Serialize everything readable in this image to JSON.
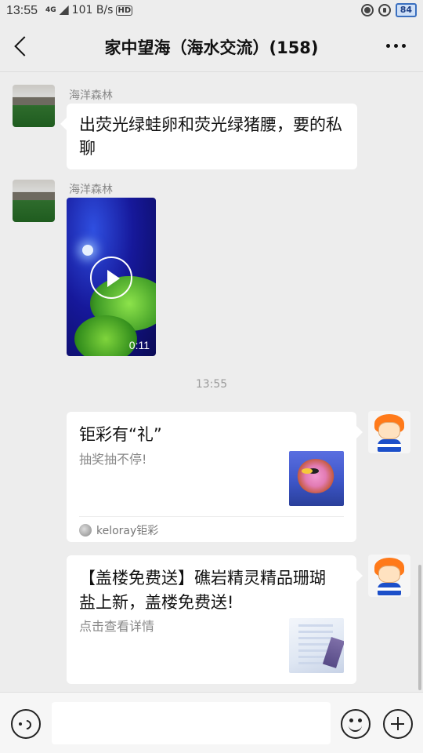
{
  "status_bar": {
    "time": "13:55",
    "network_type": "4G",
    "speed": "101 B/s",
    "hd": "HD",
    "battery": "84"
  },
  "header": {
    "title": "家中望海（海水交流）(158)"
  },
  "messages": {
    "m1": {
      "sender": "海洋森林",
      "text": "出荧光绿蛙卵和荧光绿猪腰，要的私聊"
    },
    "m2": {
      "sender": "海洋森林",
      "video_duration": "0:11"
    },
    "timestamp": "13:55",
    "card1": {
      "title": "钜彩有“礼”",
      "description": "抽奖抽不停!",
      "source": "keloray钜彩"
    },
    "card2": {
      "title": "【盖楼免费送】礁岩精灵精品珊瑚盐上新，盖楼免费送!",
      "description": "点击查看详情"
    }
  },
  "input": {
    "placeholder": ""
  },
  "icons": {
    "back": "back-arrow-icon",
    "more": "more-dots-icon",
    "voice": "voice-icon",
    "emoji": "emoji-icon",
    "plus": "plus-icon"
  }
}
